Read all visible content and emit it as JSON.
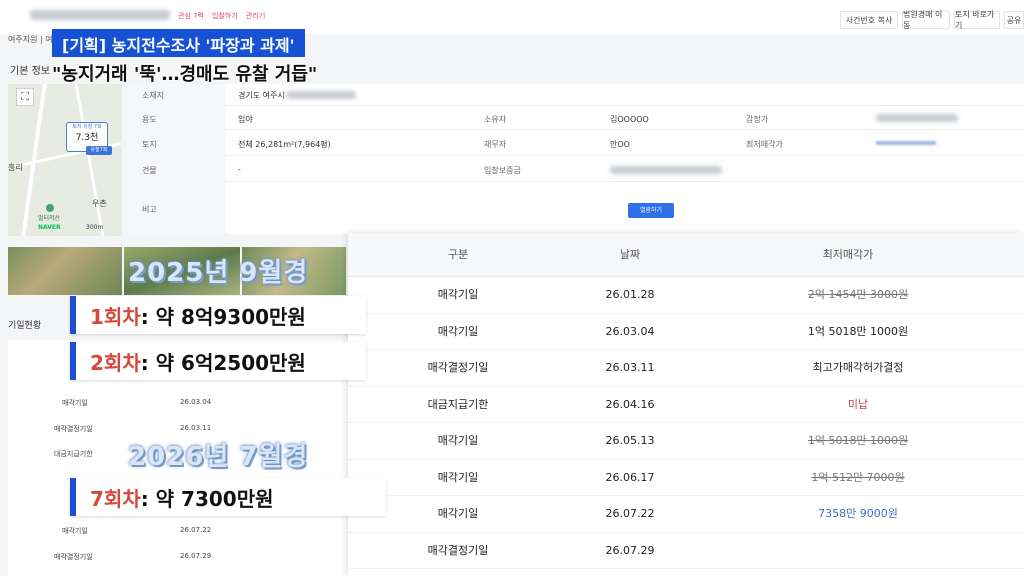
{
  "headline": {
    "tag_title": "[기획] 농지전수조사 '파장과 과제'",
    "subtitle": "\"농지거래 '뚝'…경매도 유찰 거듭\""
  },
  "top": {
    "tabs": [
      "관심 7력",
      "입찰하기",
      "관리기"
    ],
    "buttons": [
      "사건번호 복사",
      "법원경매 이동",
      "토지 바로가기",
      "공유"
    ]
  },
  "page": {
    "court": "여주지원 | 여",
    "basic_info": "기본 정보",
    "schedule_title": "기일현황"
  },
  "map": {
    "marker_top": "토지 유찰 7회",
    "marker_price": "7.3천",
    "marker_tag": "유찰7회",
    "place_left": "흥리",
    "place_right": "우촌",
    "poi": "벌터저산",
    "logo": "NAVER",
    "scale": "300m"
  },
  "info_table": {
    "location_label": "소재지",
    "location_value": "경기도 여주시",
    "use_label": "용도",
    "use_value": "임야",
    "owner_label": "소유자",
    "owner_value": "김OOOOO",
    "appraisal_label": "감정가",
    "land_label": "토지",
    "land_value": "전체 26,281m²(7,964평)",
    "debtor_label": "채무자",
    "debtor_value": "안OO",
    "minimum_label": "최저매각가",
    "building_label": "건물",
    "building_value": "-",
    "deposit_label": "입찰보증금",
    "remark_label": "비고",
    "detail_button": "열람하기"
  },
  "captions": {
    "year_2025": "2025년 9월경",
    "year_2026": "2026년 7월경"
  },
  "cards": [
    {
      "round": "1회차",
      "amount": ": 약 8억9300만원"
    },
    {
      "round": "2회차",
      "amount": ": 약 6억2500만원"
    },
    {
      "round": "7회차",
      "amount": ": 약 7300만원"
    }
  ],
  "left_schedule": [
    {
      "type": "매각기일",
      "date": "26.03.04"
    },
    {
      "type": "매각결정기일",
      "date": "26.03.11"
    },
    {
      "type": "대금지급기한",
      "date": ""
    },
    {
      "type": "매각기일",
      "date": "26.07.22"
    },
    {
      "type": "매각결정기일",
      "date": "26.07.29"
    }
  ],
  "table": {
    "headers": [
      "구분",
      "날짜",
      "최저매각가"
    ],
    "rows": [
      {
        "type": "매각기일",
        "date": "26.01.28",
        "price": "2억 1454만 3000원",
        "style": "strike"
      },
      {
        "type": "매각기일",
        "date": "26.03.04",
        "price": "1억 5018만 1000원",
        "style": "normal"
      },
      {
        "type": "매각결정기일",
        "date": "26.03.11",
        "price": "최고가매각허가결정",
        "style": "normal"
      },
      {
        "type": "대금지급기한",
        "date": "26.04.16",
        "price": "미납",
        "style": "unpaid"
      },
      {
        "type": "매각기일",
        "date": "26.05.13",
        "price": "1억 5018만 1000원",
        "style": "strike"
      },
      {
        "type": "매각기일",
        "date": "26.06.17",
        "price": "1억 512만 7000원",
        "style": "strike"
      },
      {
        "type": "매각기일",
        "date": "26.07.22",
        "price": "7358만 9000원",
        "style": "blue"
      },
      {
        "type": "매각결정기일",
        "date": "26.07.29",
        "price": "",
        "style": "normal"
      }
    ]
  },
  "colors": {
    "headline_blue": "#1752d6",
    "card_border": "#1d4fd1",
    "round_red": "#d7463a",
    "unpaid": "#c0425a",
    "current_price": "#3b6fc9"
  }
}
